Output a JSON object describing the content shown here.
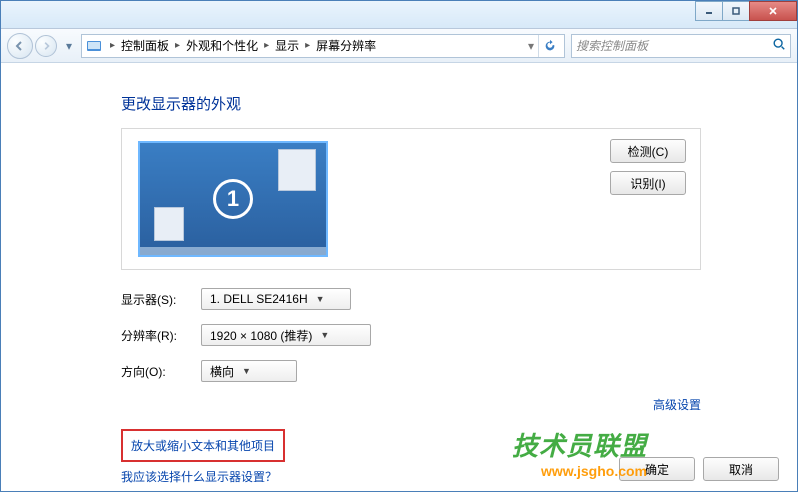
{
  "breadcrumb": {
    "items": [
      "控制面板",
      "外观和个性化",
      "显示",
      "屏幕分辨率"
    ]
  },
  "search": {
    "placeholder": "搜索控制面板"
  },
  "heading": "更改显示器的外观",
  "sideButtons": {
    "detect": "检测(C)",
    "identify": "识别(I)"
  },
  "monitor": {
    "number": "1"
  },
  "form": {
    "displayLabel": "显示器(S):",
    "displayValue": "1. DELL SE2416H",
    "resolutionLabel": "分辨率(R):",
    "resolutionValue": "1920 × 1080 (推荐)",
    "orientationLabel": "方向(O):",
    "orientationValue": "横向"
  },
  "advanced": "高级设置",
  "links": {
    "scale": "放大或缩小文本和其他项目",
    "which": "我应该选择什么显示器设置？"
  },
  "footer": {
    "ok": "确定",
    "cancel": "取消"
  },
  "watermark": {
    "cn": "技术员联盟",
    "url": "www.jsgho.com"
  }
}
